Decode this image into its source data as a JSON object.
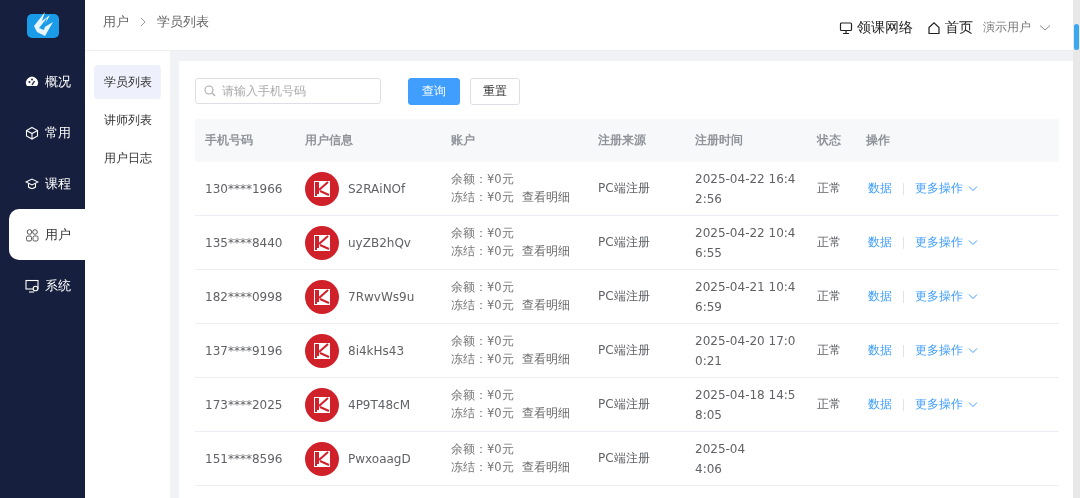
{
  "breadcrumb": [
    "用户",
    "学员列表"
  ],
  "header": {
    "site_link": "领课网络",
    "home_link": "首页",
    "user_menu": "演示用户"
  },
  "nav": [
    {
      "label": "概况",
      "selected": false
    },
    {
      "label": "常用",
      "selected": false
    },
    {
      "label": "课程",
      "selected": false
    },
    {
      "label": "用户",
      "selected": true
    },
    {
      "label": "系统",
      "selected": false
    }
  ],
  "subnav": [
    {
      "label": "学员列表",
      "selected": true
    },
    {
      "label": "讲师列表",
      "selected": false
    },
    {
      "label": "用户日志",
      "selected": false
    }
  ],
  "search": {
    "placeholder": "请输入手机号码",
    "query_button": "查询",
    "reset_button": "重置"
  },
  "table": {
    "columns": [
      "手机号码",
      "用户信息",
      "账户",
      "注册来源",
      "注册时间",
      "状态",
      "操作"
    ],
    "rows": [
      {
        "phone": "130****1966",
        "nickname": "S2RAiNOf",
        "balance": "余额：¥0元",
        "frozen": "冻结：¥0元",
        "detail_link": "查看明细",
        "source": "PC端注册",
        "time": [
          "2025-04-22 16:4",
          "2:56"
        ],
        "status": "正常",
        "data_link": "数据",
        "more_link": "更多操作"
      },
      {
        "phone": "135****8440",
        "nickname": "uyZB2hQv",
        "balance": "余额：¥0元",
        "frozen": "冻结：¥0元",
        "detail_link": "查看明细",
        "source": "PC端注册",
        "time": [
          "2025-04-22 10:4",
          "6:55"
        ],
        "status": "正常",
        "data_link": "数据",
        "more_link": "更多操作"
      },
      {
        "phone": "182****0998",
        "nickname": "7RwvWs9u",
        "balance": "余额：¥0元",
        "frozen": "冻结：¥0元",
        "detail_link": "查看明细",
        "source": "PC端注册",
        "time": [
          "2025-04-21 10:4",
          "6:59"
        ],
        "status": "正常",
        "data_link": "数据",
        "more_link": "更多操作"
      },
      {
        "phone": "137****9196",
        "nickname": "8i4kHs43",
        "balance": "余额：¥0元",
        "frozen": "冻结：¥0元",
        "detail_link": "查看明细",
        "source": "PC端注册",
        "time": [
          "2025-04-20 17:0",
          "0:21"
        ],
        "status": "正常",
        "data_link": "数据",
        "more_link": "更多操作"
      },
      {
        "phone": "173****2025",
        "nickname": "4P9T48cM",
        "balance": "余额：¥0元",
        "frozen": "冻结：¥0元",
        "detail_link": "查看明细",
        "source": "PC端注册",
        "time": [
          "2025-04-18 14:5",
          "8:05"
        ],
        "status": "正常",
        "data_link": "数据",
        "more_link": "更多操作"
      },
      {
        "phone": "151****8596",
        "nickname": "PwxoaagD",
        "balance": "余额：¥0元",
        "frozen": "冻结：¥0元",
        "detail_link": "查看明细",
        "source": "PC端注册",
        "time": [
          "2025-04",
          "4:06"
        ]
      }
    ]
  }
}
